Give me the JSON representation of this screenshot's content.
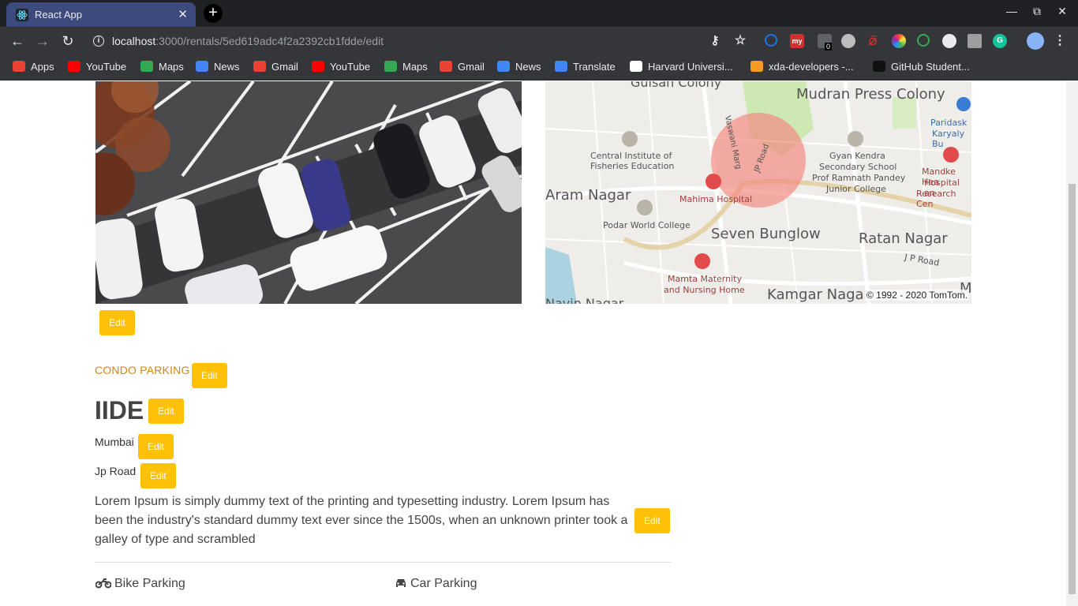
{
  "browser": {
    "tab_title": "React App",
    "tab_close": "✕",
    "new_tab": "+",
    "url_host": "localhost",
    "url_path": ":3000/rentals/5ed619adc4f2a2392cb1fdde/edit",
    "ext_badge": "0"
  },
  "bookmarks": [
    {
      "label": "Apps",
      "icon": "apps-icon",
      "color": "#ea4335"
    },
    {
      "label": "YouTube",
      "icon": "youtube-icon",
      "color": "#ff0000"
    },
    {
      "label": "Maps",
      "icon": "maps-icon",
      "color": "#34a853"
    },
    {
      "label": "News",
      "icon": "news-icon",
      "color": "#4285f4"
    },
    {
      "label": "Gmail",
      "icon": "gmail-icon",
      "color": "#ea4335"
    },
    {
      "label": "YouTube",
      "icon": "youtube-icon",
      "color": "#ff0000"
    },
    {
      "label": "Maps",
      "icon": "maps-icon",
      "color": "#34a853"
    },
    {
      "label": "Gmail",
      "icon": "gmail-icon",
      "color": "#ea4335"
    },
    {
      "label": "News",
      "icon": "news-icon",
      "color": "#4285f4"
    },
    {
      "label": "Translate",
      "icon": "translate-icon",
      "color": "#4285f4"
    },
    {
      "label": "Harvard Universi...",
      "icon": "edx-icon",
      "color": "#ffffff"
    },
    {
      "label": "xda-developers -...",
      "icon": "xda-icon",
      "color": "#f59a23"
    },
    {
      "label": "GitHub Student...",
      "icon": "github-icon",
      "color": "#111111"
    }
  ],
  "map": {
    "labels": {
      "gulsan": "Gulsan Colony",
      "mudran": "Mudran Press Colony",
      "paridask": "Paridask",
      "karyaly": "Karyaly Bu",
      "cife1": "Central Institute of",
      "cife2": "Fisheries Education",
      "vaswani": "Vaswani Marg",
      "jproad": "JP Road",
      "gyan1": "Gyan Kendra",
      "gyan2": "Secondary School",
      "gyan3": "Prof Ramnath Pandey",
      "gyan4": "Junior College",
      "mandke1": "Mandke Hea",
      "mandke2": "Hospital an",
      "mandke3": "Research Cen",
      "aram": "Aram Nagar",
      "mahima": "Mahima Hospital",
      "podar": "Podar World College",
      "seven": "Seven Bunglow",
      "ratan": "Ratan Nagar",
      "jproad2": "J P Road",
      "mamta1": "Mamta Maternity",
      "mamta2": "and Nursing Home",
      "kamgar": "Kamgar Naga",
      "navin": "Navin Nagar",
      "ma": "Ma",
      "copyright": "© 1992 - 2020 TomTom."
    }
  },
  "rental": {
    "category": "CONDO PARKING",
    "title": "IIDE",
    "city": "Mumbai",
    "street": "Jp Road",
    "description": "Lorem Ipsum is simply dummy text of the printing and typesetting industry. Lorem Ipsum has been the industry's standard dummy text ever since the 1500s, when an unknown printer took a galley of type and scrambled",
    "edit_label": "Edit",
    "amenities": [
      "Bike Parking",
      "Car Parking"
    ]
  }
}
